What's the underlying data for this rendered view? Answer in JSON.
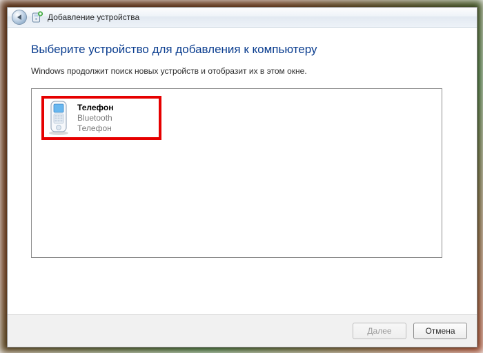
{
  "titlebar": {
    "title": "Добавление устройства"
  },
  "content": {
    "heading": "Выберите устройство для добавления к компьютеру",
    "subtext": "Windows продолжит поиск новых устройств и отобразит их в этом окне."
  },
  "device": {
    "name": "Телефон",
    "conn": "Bluetooth",
    "type": "Телефон",
    "icon": "phone-icon"
  },
  "footer": {
    "next": "Далее",
    "cancel": "Отмена"
  },
  "colors": {
    "heading": "#0a3d8f",
    "highlight_border": "#e60000"
  }
}
